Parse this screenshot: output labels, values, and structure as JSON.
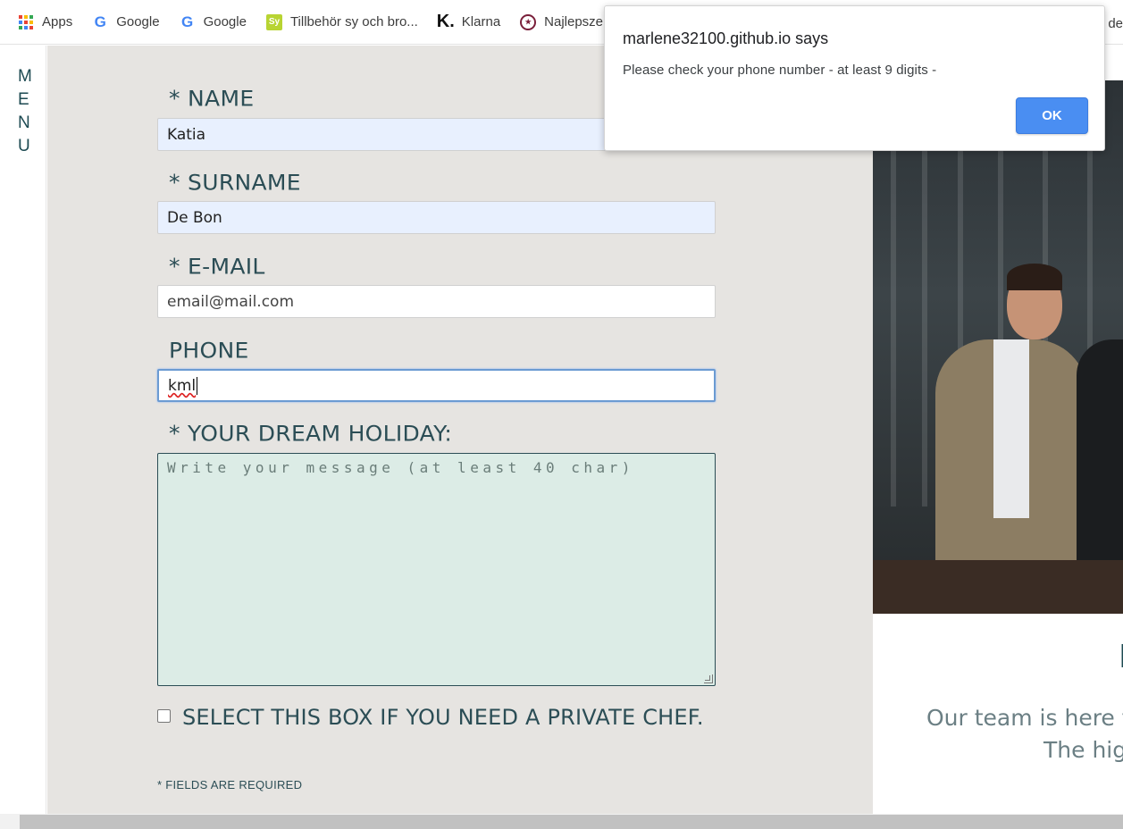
{
  "bookmarks": [
    {
      "label": "Apps",
      "icon": "apps-grid-icon"
    },
    {
      "label": "Google",
      "icon": "google-icon"
    },
    {
      "label": "Google",
      "icon": "google-icon"
    },
    {
      "label": "Tillbehör sy och bro...",
      "icon": "sy-icon"
    },
    {
      "label": "Klarna",
      "icon": "klarna-icon"
    },
    {
      "label": "Najlepsze",
      "icon": "najlepsze-icon"
    }
  ],
  "bookmarks_overflow": "de",
  "menu": {
    "letters": [
      "M",
      "E",
      "N",
      "U"
    ]
  },
  "form": {
    "name": {
      "label": "* NAME",
      "value": "Katia"
    },
    "surname": {
      "label": "* SURNAME",
      "value": "De Bon"
    },
    "email": {
      "label": "* E-MAIL",
      "placeholder": "email@mail.com"
    },
    "phone": {
      "label": "PHONE",
      "value": "kml"
    },
    "holiday": {
      "label": "* YOUR DREAM HOLIDAY:",
      "placeholder": "Write your message (at least 40 char)"
    },
    "chef_checkbox": {
      "label": "SELECT THIS BOX IF YOU NEED A PRIVATE CHEF.",
      "checked": false
    },
    "required_note": "* FIELDS ARE REQUIRED"
  },
  "team": {
    "heading": "I",
    "line1": "Our team is here t",
    "line2": "The hig"
  },
  "dialog": {
    "title": "marlene32100.github.io says",
    "message": "Please check your phone number - at least 9 digits -",
    "ok_label": "OK"
  },
  "colors": {
    "accent": "#2b4d55",
    "form_bg": "#e6e4e1",
    "textarea_bg": "#dcece6",
    "ok_button": "#4a8ef2"
  }
}
